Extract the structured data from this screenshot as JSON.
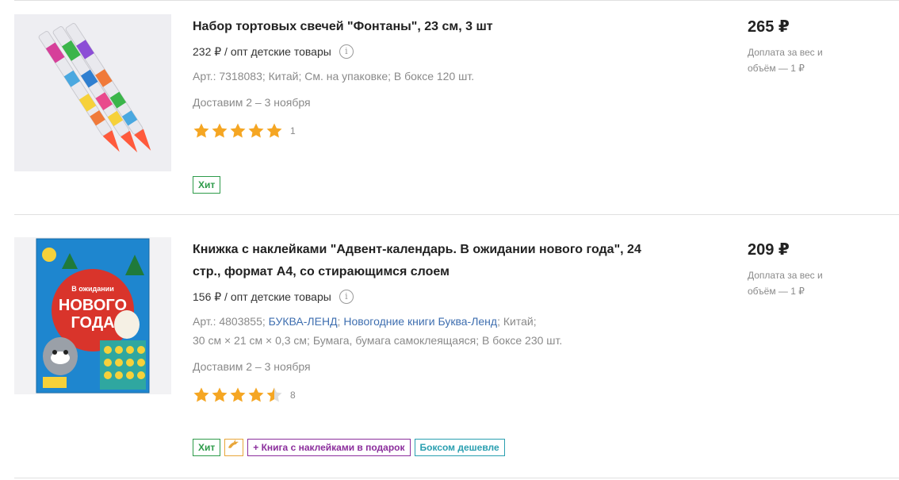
{
  "products": [
    {
      "title": "Набор тортовых свечей \"Фонтаны\", 23 см, 3 шт",
      "opt_price": "232 ₽ / опт детские товары",
      "attrs_line1": "Арт.: 7318083; Китай; См. на упаковке; В боксе 120 шт.",
      "delivery": "Доставим 2 – 3 ноября",
      "rating": 5,
      "review_count": "1",
      "badges": [
        "Хит"
      ],
      "price": "265 ₽",
      "surcharge": "Доплата за вес и объём — 1 ₽"
    },
    {
      "title": "Книжка с наклейками \"Адвент-календарь. В ожидании нового года\", 24 стр., формат А4, со стирающимся слоем",
      "opt_price": "156 ₽ / опт детские товары",
      "attrs": {
        "art": "Арт.: 4803855;",
        "brand_link": "БУКВА-ЛЕНД",
        "series_link": "Новогодние книги Буква-Ленд",
        "country": "; Китай;",
        "line2": "30 см × 21 см × 0,3 см; Бумага, бумага самоклеящаяся; В боксе 230 шт."
      },
      "delivery": "Доставим 2 – 3 ноября",
      "rating": 4.5,
      "review_count": "8",
      "badges": [
        "Хит",
        "+ Книга с наклейками в подарок",
        "Боксом дешевле"
      ],
      "price": "209 ₽",
      "surcharge": "Доплата за вес и объём — 1 ₽",
      "cover_text": {
        "line1": "В ожидании",
        "line2": "НОВОГО",
        "line3": "ГОДА"
      }
    }
  ],
  "info_icon_glyph": "i",
  "colors": {
    "star": "#f5a623",
    "star_empty": "#dddddd",
    "hit": "#2e9b4a",
    "gift": "#8b2e9c",
    "box": "#2a9fb0",
    "link": "#3f6fb0"
  },
  "icons": {
    "info": "info-circle-icon",
    "star": "star-icon",
    "delivery_badge": "dolphin-icon"
  }
}
